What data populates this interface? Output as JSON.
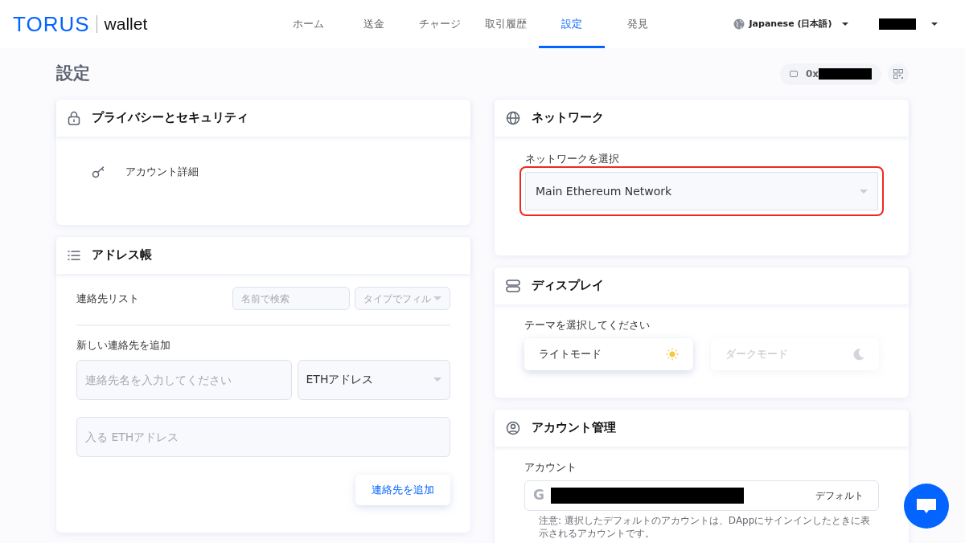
{
  "brand": {
    "logo": "TORUS",
    "product": "wallet"
  },
  "nav": [
    {
      "label": "ホーム",
      "selected": false
    },
    {
      "label": "送金",
      "selected": false
    },
    {
      "label": "チャージ",
      "selected": false
    },
    {
      "label": "取引履歴",
      "selected": false
    },
    {
      "label": "設定",
      "selected": true
    },
    {
      "label": "発見",
      "selected": false
    }
  ],
  "language": {
    "label": "Japanese (日本語)"
  },
  "page_title": "設定",
  "address": {
    "prefix": "0x"
  },
  "privacy": {
    "title": "プライバシーとセキュリティ",
    "items": [
      {
        "label": "アカウント詳細"
      }
    ]
  },
  "address_book": {
    "title": "アドレス帳",
    "list_label": "連絡先リスト",
    "search": {
      "placeholder": "名前で検索"
    },
    "filter": {
      "placeholder": "タイプでフィル"
    },
    "add_label": "新しい連絡先を追加",
    "name_field": {
      "placeholder": "連絡先名を入力してください"
    },
    "type_select": {
      "value": "ETHアドレス"
    },
    "address_field": {
      "placeholder": "入る ETHアドレス"
    },
    "add_button": "連絡先を追加"
  },
  "network": {
    "title": "ネットワーク",
    "select_label": "ネットワークを選択",
    "value": "Main Ethereum Network",
    "highlighted": true
  },
  "display": {
    "title": "ディスプレイ",
    "prompt": "テーマを選択してください",
    "themes": [
      {
        "label": "ライトモード",
        "kind": "light",
        "selected": true
      },
      {
        "label": "ダークモード",
        "kind": "dark",
        "selected": false
      }
    ]
  },
  "account": {
    "title": "アカウント管理",
    "label": "アカウント",
    "accounts": [
      {
        "provider_mark": "G",
        "badge": "デフォルト"
      }
    ],
    "note": "注意: 選択したデフォルトのアカウントは、DAppにサインインしたときに表示されるアカウントです。"
  }
}
